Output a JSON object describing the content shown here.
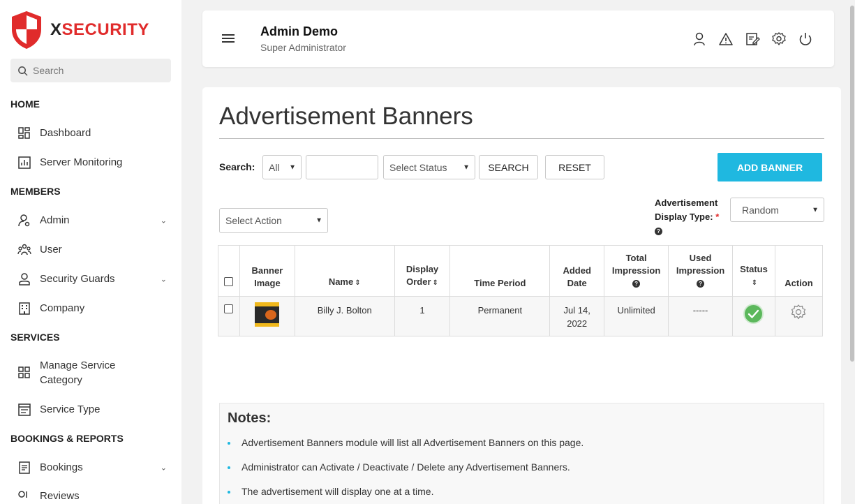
{
  "brand": {
    "prefix": "X",
    "suffix": "SECURITY",
    "accent": "#e02b2b"
  },
  "sidebar": {
    "search_placeholder": "Search",
    "sections": {
      "home": "HOME",
      "members": "MEMBERS",
      "services": "SERVICES",
      "bookings": "BOOKINGS & REPORTS"
    },
    "items": {
      "dashboard": "Dashboard",
      "server_monitoring": "Server Monitoring",
      "admin": "Admin",
      "user": "User",
      "security_guards": "Security Guards",
      "company": "Company",
      "manage_service_category_1": "Manage Service",
      "manage_service_category_2": "Category",
      "service_type": "Service Type",
      "bookings": "Bookings",
      "reviews": "Reviews"
    }
  },
  "header": {
    "name": "Admin Demo",
    "role": "Super Administrator",
    "icons": [
      "user-icon",
      "alert-icon",
      "edit-icon",
      "settings-icon",
      "power-icon"
    ]
  },
  "page": {
    "title": "Advertisement Banners",
    "search_label": "Search:",
    "search_scope": "All",
    "status_placeholder": "Select Status",
    "search_button": "SEARCH",
    "reset_button": "RESET",
    "add_button": "ADD BANNER",
    "bulk_action": "Select Action",
    "display_type_label_1": "Advertisement",
    "display_type_label_2": "Display Type:",
    "required_mark": "*",
    "display_type_value": "Random",
    "accent": "#1fb8e0"
  },
  "table": {
    "headers": {
      "banner_1": "Banner",
      "banner_2": "Image",
      "name": "Name",
      "order_1": "Display",
      "order_2": "Order",
      "period": "Time Period",
      "added_1": "Added",
      "added_2": "Date",
      "total_1": "Total",
      "total_2": "Impression",
      "used_1": "Used",
      "used_2": "Impression",
      "status": "Status",
      "action": "Action"
    },
    "rows": [
      {
        "name": "Billy J. Bolton",
        "order": "1",
        "period": "Permanent",
        "added_1": "Jul 14,",
        "added_2": "2022",
        "total": "Unlimited",
        "used": "-----"
      }
    ]
  },
  "notes": {
    "title": "Notes:",
    "items": [
      "Advertisement Banners module will list all Advertisement Banners on this page.",
      "Administrator can Activate / Deactivate / Delete any Advertisement Banners.",
      "The advertisement will display one at a time."
    ]
  }
}
